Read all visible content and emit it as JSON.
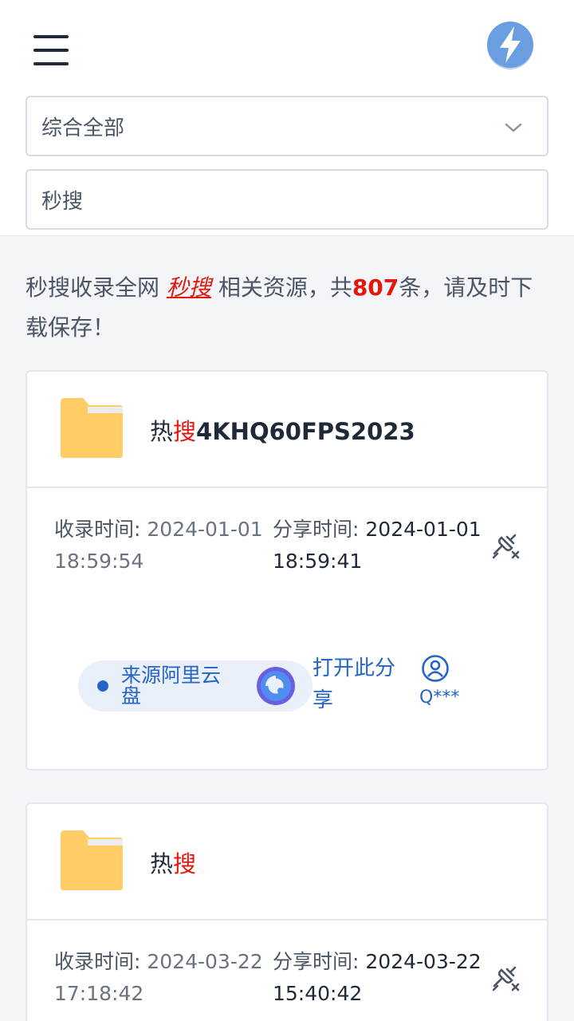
{
  "header": {
    "menu_icon": "hamburger-menu-icon",
    "logo_icon": "lightning-bolt-icon",
    "accent_color": "#6a9ee0"
  },
  "filter": {
    "selected": "综合全部"
  },
  "search": {
    "value": "秒搜"
  },
  "summary": {
    "prefix": "秒搜收录全网 ",
    "keyword": "秒搜",
    "middle": " 相关资源，共",
    "count": "807",
    "suffix": "条，请及时下载保存！"
  },
  "results": [
    {
      "title_hot": "热",
      "title_keyword": "搜",
      "title_rest": "4KHQ60FPS2023",
      "collected_label": "收录时间:",
      "collected_date": "2024-01-01",
      "collected_time": "18:59:54",
      "shared_label": "分享时间:",
      "shared_date": "2024-01-01",
      "shared_time": "18:59:41",
      "source": "来源阿里云盘",
      "open_label": "打开此分享",
      "user": "Q***"
    },
    {
      "title_hot": "热",
      "title_keyword": "搜",
      "collected_label": "收录时间:",
      "collected_date": "2024-03-22",
      "collected_time": "17:18:42",
      "shared_label": "分享时间:",
      "shared_date": "2024-03-22",
      "shared_time": "15:40:42"
    }
  ],
  "colors": {
    "highlight": "#e5160b",
    "link": "#2565c7",
    "folder": "#ffcc66"
  }
}
